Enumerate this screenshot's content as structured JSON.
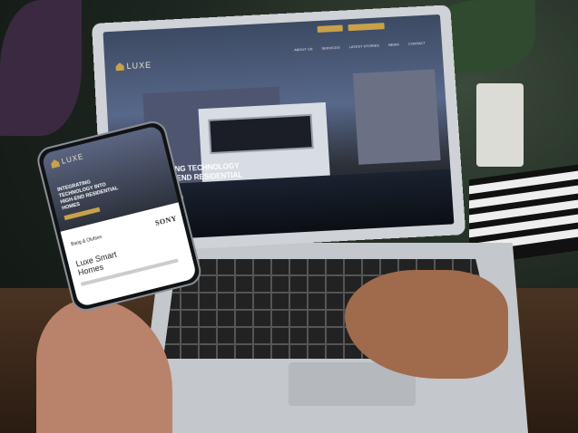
{
  "laptop_site": {
    "logo": "LUXE",
    "hero_title": "INTEGRATING TECHNOLOGY INTO HIGH-END RESIDENTIAL HOMES",
    "nav_items": [
      "ABOUT US",
      "SERVICES",
      "LATEST STORIES",
      "NEWS",
      "CONTACT"
    ]
  },
  "phone_site": {
    "logo": "LUXE",
    "hero_title": "INTEGRATING TECHNOLOGY INTO HIGH-END RESIDENTIAL HOMES",
    "partner_label": "Bang & Olufsen",
    "brand": "SONY",
    "section_heading": "Luxe Smart Homes"
  }
}
